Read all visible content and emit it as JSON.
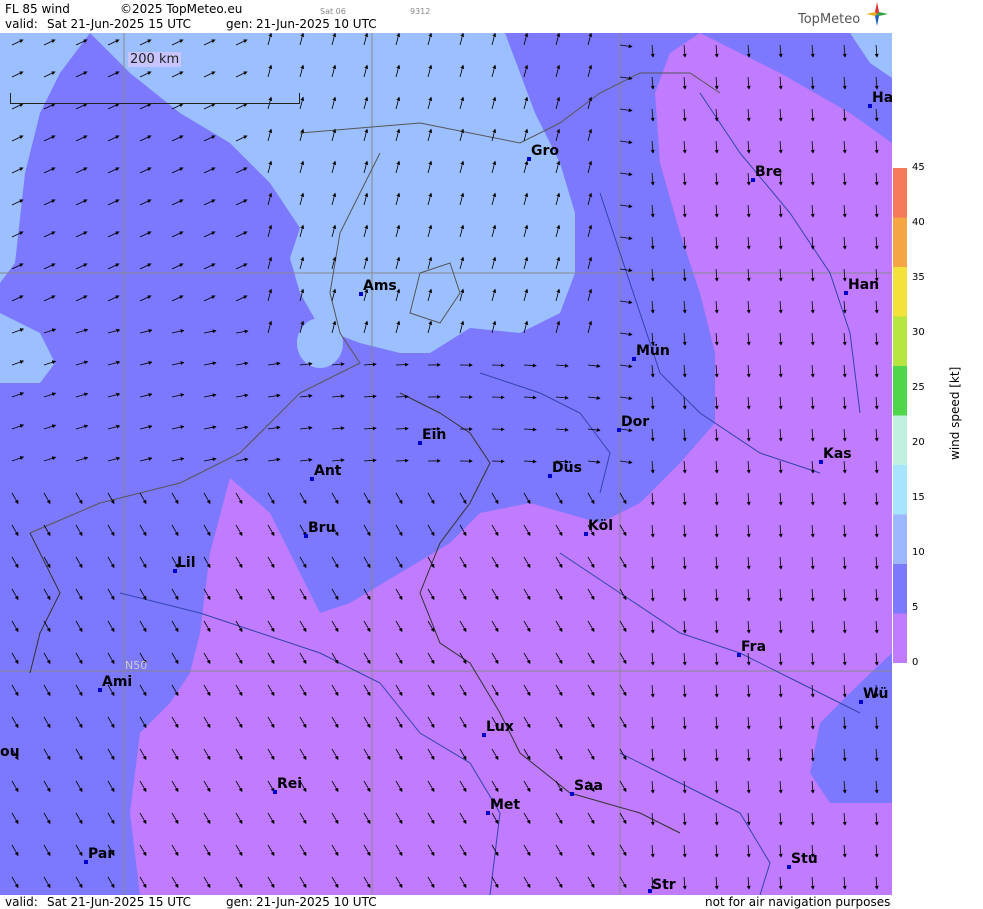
{
  "header": {
    "title": "FL 85 wind",
    "copyright": "©2025 TopMeteo.eu",
    "sat": "Sat 06",
    "code": "9312",
    "valid_label": "valid:",
    "valid_value": "Sat  21-Jun-2025  15 UTC",
    "gen_label": "gen:",
    "gen_value": "21-Jun-2025 10 UTC",
    "logo": "TopMeteo"
  },
  "footer": {
    "valid_label": "valid:",
    "valid_value": "Sat  21-Jun-2025  15 UTC",
    "gen_label": "gen:",
    "gen_value": "21-Jun-2025 10 UTC",
    "disclaimer": "not for air navigation purposes"
  },
  "scale_label": "200 km",
  "latitude_label": "N50",
  "colorbar": {
    "title": "wind  speed  [kt]",
    "ticks": [
      "45",
      "40",
      "35",
      "30",
      "25",
      "20",
      "15",
      "10",
      "5",
      "0"
    ],
    "colors": [
      "#f47a5a",
      "#f5a642",
      "#f3e23a",
      "#b7e640",
      "#4fd64a",
      "#bff0e0",
      "#a6e4ff",
      "#9db8ff",
      "#7d79ff",
      "#c07bff"
    ]
  },
  "cities": [
    {
      "name": "Gro"
    },
    {
      "name": "Bre"
    },
    {
      "name": "Ha"
    },
    {
      "name": "Ams"
    },
    {
      "name": "Han"
    },
    {
      "name": "Mün"
    },
    {
      "name": "Ein"
    },
    {
      "name": "Dor"
    },
    {
      "name": "Ant"
    },
    {
      "name": "Düs"
    },
    {
      "name": "Kas"
    },
    {
      "name": "Bru"
    },
    {
      "name": "Köl"
    },
    {
      "name": "Lil"
    },
    {
      "name": "Fra"
    },
    {
      "name": "Ami"
    },
    {
      "name": "Wü"
    },
    {
      "name": "ou"
    },
    {
      "name": "Lux"
    },
    {
      "name": "Rei"
    },
    {
      "name": "Saa"
    },
    {
      "name": "Met"
    },
    {
      "name": "Par"
    },
    {
      "name": "Stu"
    },
    {
      "name": "Str"
    }
  ]
}
